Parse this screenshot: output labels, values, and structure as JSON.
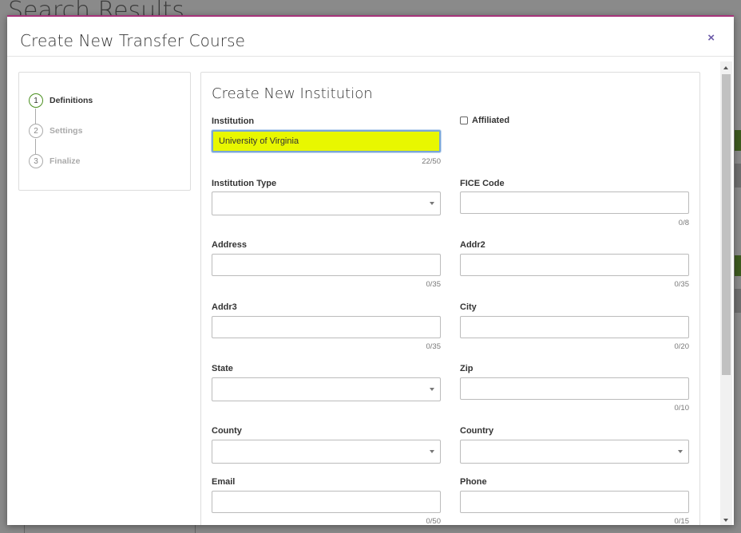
{
  "background": {
    "page_title": "Search Results"
  },
  "modal": {
    "title": "Create New Transfer Course",
    "close_label": "×"
  },
  "stepper": {
    "steps": [
      {
        "number": "1",
        "label": "Definitions",
        "active": true
      },
      {
        "number": "2",
        "label": "Settings",
        "active": false
      },
      {
        "number": "3",
        "label": "Finalize",
        "active": false
      }
    ]
  },
  "form": {
    "title": "Create New Institution",
    "institution": {
      "label": "Institution",
      "value": "University of Virginia",
      "counter": "22/50"
    },
    "affiliated": {
      "label": "Affiliated",
      "checked": false
    },
    "institution_type": {
      "label": "Institution Type",
      "value": ""
    },
    "fice_code": {
      "label": "FICE Code",
      "value": "",
      "counter": "0/8"
    },
    "address": {
      "label": "Address",
      "value": "",
      "counter": "0/35"
    },
    "addr2": {
      "label": "Addr2",
      "value": "",
      "counter": "0/35"
    },
    "addr3": {
      "label": "Addr3",
      "value": "",
      "counter": "0/35"
    },
    "city": {
      "label": "City",
      "value": "",
      "counter": "0/20"
    },
    "state": {
      "label": "State",
      "value": ""
    },
    "zip": {
      "label": "Zip",
      "value": "",
      "counter": "0/10"
    },
    "county": {
      "label": "County",
      "value": ""
    },
    "country": {
      "label": "Country",
      "value": ""
    },
    "email": {
      "label": "Email",
      "value": "",
      "counter": "0/50"
    },
    "phone": {
      "label": "Phone",
      "value": "",
      "counter": "0/15"
    }
  },
  "colors": {
    "accent": "#a6337a",
    "active_step": "#4a8f1f",
    "highlight_input": "#e8f700",
    "close_icon": "#6b5aa8"
  }
}
